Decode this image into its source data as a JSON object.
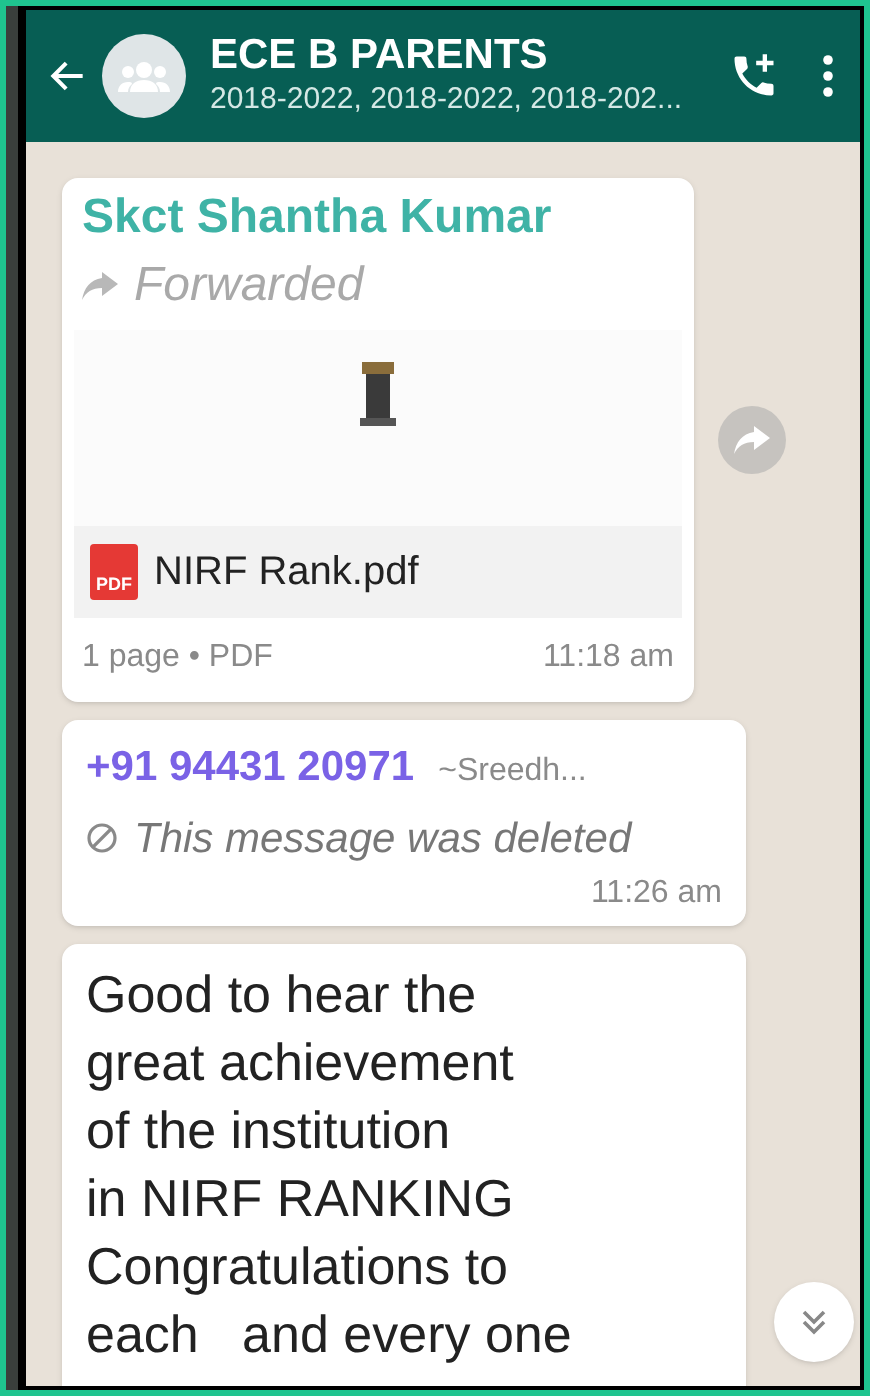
{
  "header": {
    "title": "ECE B PARENTS",
    "subtitle": "2018-2022, 2018-2022, 2018-202..."
  },
  "messages": [
    {
      "kind": "document",
      "sender": "Skct Shantha Kumar",
      "forwarded": true,
      "forwarded_label": "Forwarded",
      "file_name": "NIRF Rank.pdf",
      "file_badge": "PDF",
      "file_info": "1 page • PDF",
      "time": "11:18 am"
    },
    {
      "kind": "deleted",
      "sender": "+91 94431 20971",
      "sender_name": "~Sreedh...",
      "text": "This message was deleted",
      "time": "11:26 am"
    },
    {
      "kind": "text",
      "text": "Good to hear the\ngreat achievement\nof the institution\nin NIRF RANKING\nCongratulations to\neach   and every one"
    }
  ]
}
